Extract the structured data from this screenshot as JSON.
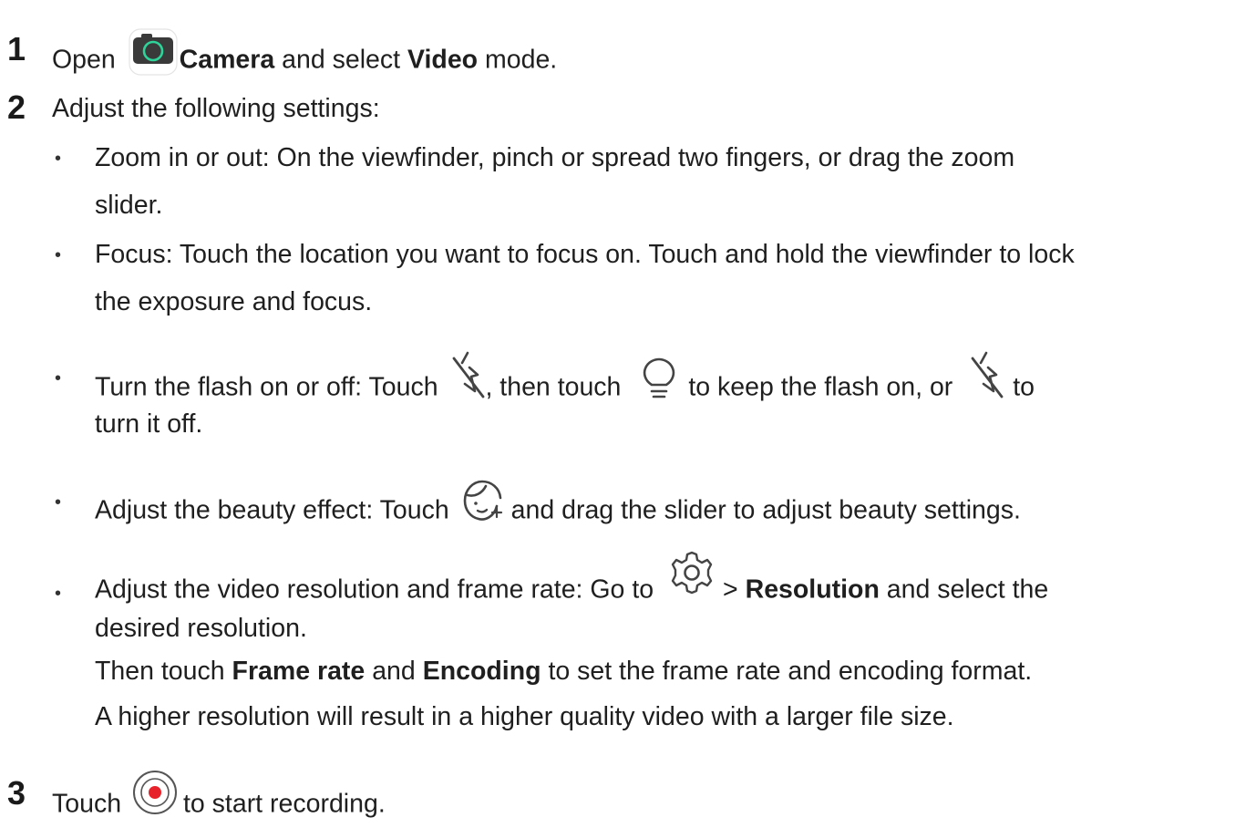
{
  "steps": [
    {
      "number": "1",
      "open": "Open",
      "camera": "Camera",
      "and_select": "and select",
      "video": "Video",
      "mode": "mode."
    },
    {
      "number": "2",
      "text": "Adjust the following settings:"
    },
    {
      "number": "3",
      "touch": "Touch",
      "to_start": "to start recording."
    }
  ],
  "bullets": {
    "zoom": {
      "line1": "Zoom in or out: On the viewfinder, pinch or spread two fingers, or drag the zoom",
      "line2": "slider."
    },
    "focus": {
      "line1": "Focus: Touch the location you want to focus on. Touch and hold the viewfinder to lock",
      "line2": "the exposure and focus."
    },
    "flash": {
      "part1": "Turn the flash on or off: Touch",
      "part2": ", then touch",
      "part3": "to keep the flash on, or",
      "part4": "to",
      "line2": "turn it off."
    },
    "beauty": {
      "part1": "Adjust the beauty effect: Touch",
      "part2": "and drag the slider to adjust beauty settings."
    },
    "resolution": {
      "part1": "Adjust the video resolution and frame rate: Go to",
      "part2": ">",
      "resolution": "Resolution",
      "part3": "and select the",
      "line2": "desired resolution.",
      "line3_a": "Then touch",
      "frame_rate": "Frame rate",
      "line3_b": "and",
      "encoding": "Encoding",
      "line3_c": "to set the frame rate and encoding format.",
      "line4": "A higher resolution will result in a higher quality video with a larger file size."
    }
  },
  "icons": {
    "camera_app": "camera-app-icon",
    "flash_off": "flash-off-icon",
    "flash_on": "bulb-icon",
    "beauty": "beauty-face-icon",
    "settings": "gear-icon",
    "record": "record-icon"
  },
  "colors": {
    "text": "#1f1f1f",
    "camera_green": "#2ed39a",
    "record_red": "#e8222a"
  }
}
